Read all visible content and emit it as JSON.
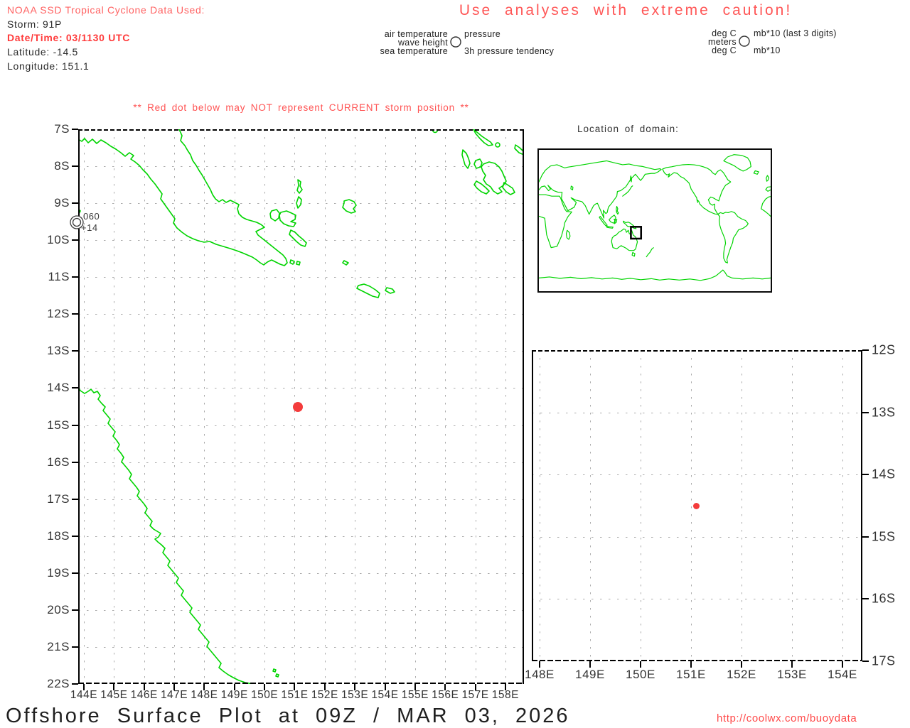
{
  "header": {
    "source_line": "NOAA SSD Tropical Cyclone Data Used:",
    "storm_line": "Storm: 91P",
    "datetime_line": "Date/Time: 03/1130 UTC",
    "latitude_line": "Latitude: -14.5",
    "longitude_line": "Longitude: 151.1"
  },
  "caution_banner": "Use analyses with extreme caution!",
  "station_model_legend": {
    "left_labels": [
      "air temperature",
      "wave height",
      "sea temperature"
    ],
    "right_labels": [
      "pressure",
      "3h pressure tendency"
    ]
  },
  "units_legend": {
    "left_labels": [
      "deg C",
      "meters",
      "deg C"
    ],
    "right_labels": [
      "mb*10 (last 3 digits)",
      "mb*10"
    ]
  },
  "warning_note": "** Red dot below may NOT represent CURRENT storm position **",
  "main_map": {
    "lat_labels": [
      "7S",
      "8S",
      "9S",
      "10S",
      "11S",
      "12S",
      "13S",
      "14S",
      "15S",
      "16S",
      "17S",
      "18S",
      "19S",
      "20S",
      "21S",
      "22S"
    ],
    "lon_labels": [
      "144E",
      "145E",
      "146E",
      "147E",
      "148E",
      "149E",
      "150E",
      "151E",
      "152E",
      "153E",
      "154E",
      "155E",
      "156E",
      "157E",
      "158E"
    ],
    "storm_dot": {
      "lon_e": 151.1,
      "lat_s": 14.5
    },
    "station_report": {
      "pressure": "060",
      "pressure_tendency": "+14"
    }
  },
  "inset_map": {
    "title": "Location of domain:"
  },
  "sub_map": {
    "lat_labels": [
      "12S",
      "13S",
      "14S",
      "15S",
      "16S",
      "17S"
    ],
    "lon_labels": [
      "148E",
      "149E",
      "150E",
      "151E",
      "152E",
      "153E",
      "154E"
    ],
    "storm_dot": {
      "lon_e": 151.1,
      "lat_s": 14.5
    }
  },
  "footer": {
    "title": "Offshore Surface Plot at 09Z / MAR 03, 2026",
    "url": "http://coolwx.com/buoydata"
  },
  "colors": {
    "coastline_green": "#00d400",
    "storm_red": "#f43c3c",
    "light_red_text": "#ff6262",
    "strong_red_text": "#ff3b3b",
    "caution_red": "#ff5757",
    "axis_text": "#333333"
  }
}
